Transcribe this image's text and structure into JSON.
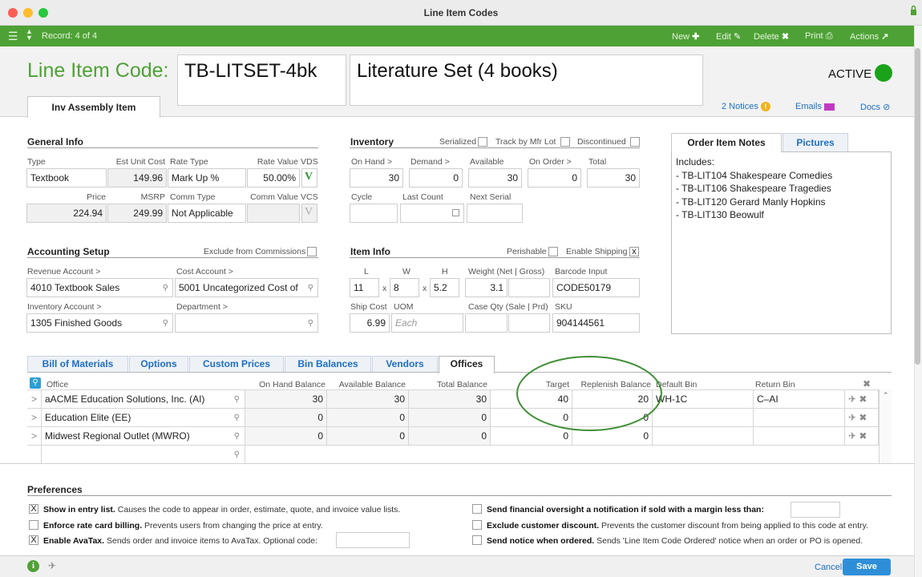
{
  "window": {
    "title": "Line Item Codes"
  },
  "toolbar": {
    "record": "Record: 4 of 4",
    "new": "New",
    "edit": "Edit",
    "delete": "Delete",
    "print": "Print",
    "actions": "Actions"
  },
  "header": {
    "code_label": "Line Item Code:",
    "code": "TB-LITSET-4bk",
    "description": "Literature Set (4 books)",
    "status": "ACTIVE",
    "type_tab": "Inv Assembly Item",
    "notices": "2 Notices",
    "emails": "Emails",
    "docs": "Docs"
  },
  "general": {
    "title": "General Info",
    "type_label": "Type",
    "type": "Textbook",
    "est_label": "Est Unit Cost",
    "est": "149.96",
    "rate_type_label": "Rate Type",
    "rate_type": "Mark Up %",
    "rate_value_label": "Rate Value",
    "rate_value": "50.00%",
    "vds_label": "VDS",
    "vds": "V",
    "price_label": "Price",
    "price": "224.94",
    "msrp_label": "MSRP",
    "msrp": "249.99",
    "comm_type_label": "Comm Type",
    "comm_type": "Not Applicable",
    "comm_value_label": "Comm Value",
    "vcs_label": "VCS",
    "vcs": "V"
  },
  "inventory": {
    "title": "Inventory",
    "serialized": "Serialized",
    "track": "Track by Mfr Lot",
    "discontinued": "Discontinued",
    "on_hand_label": "On Hand >",
    "on_hand": "30",
    "demand_label": "Demand >",
    "demand": "0",
    "available_label": "Available",
    "available": "30",
    "on_order_label": "On Order >",
    "on_order": "0",
    "total_label": "Total",
    "total": "30",
    "cycle_label": "Cycle",
    "last_count_label": "Last Count",
    "next_serial_label": "Next Serial"
  },
  "notes": {
    "tab_notes": "Order Item Notes",
    "tab_pictures": "Pictures",
    "lines": [
      "Includes:",
      "- TB-LIT104 Shakespeare Comedies",
      "- TB-LIT106 Shakespeare Tragedies",
      "- TB-LIT120 Gerard Manly Hopkins",
      "- TB-LIT130 Beowulf"
    ]
  },
  "accounting": {
    "title": "Accounting Setup",
    "exclude": "Exclude from Commissions",
    "revenue_label": "Revenue Account >",
    "revenue": "4010 Textbook Sales",
    "cost_label": "Cost Account >",
    "cost": "5001 Uncategorized Cost of",
    "inventory_label": "Inventory Account >",
    "inventory": "1305 Finished Goods",
    "department_label": "Department >"
  },
  "iteminfo": {
    "title": "Item Info",
    "perishable": "Perishable",
    "enable_shipping": "Enable Shipping",
    "shipping_check": "x",
    "l_label": "L",
    "l": "11",
    "w_label": "W",
    "w": "8",
    "h_label": "H",
    "h": "5.2",
    "x": "x",
    "weight_label": "Weight (Net | Gross)",
    "weight": "3.1",
    "barcode_label": "Barcode Input",
    "barcode": "CODE50179",
    "ship_cost_label": "Ship Cost",
    "ship_cost": "6.99",
    "uom_label": "UOM",
    "uom": "Each",
    "case_label": "Case Qty (Sale | Prd)",
    "sku_label": "SKU",
    "sku": "904144561"
  },
  "subtabs": [
    "Bill of Materials",
    "Options",
    "Custom Prices",
    "Bin Balances",
    "Vendors",
    "Offices"
  ],
  "offices": {
    "headers": {
      "office": "Office",
      "on_hand": "On Hand Balance",
      "available": "Available Balance",
      "total": "Total Balance",
      "target": "Target",
      "replenish": "Replenish Balance",
      "default_bin": "Default Bin",
      "return_bin": "Return Bin"
    },
    "rows": [
      {
        "office": "aACME Education Solutions, Inc.  (AI)",
        "on_hand": "30",
        "available": "30",
        "total": "30",
        "target": "40",
        "replenish": "20",
        "default_bin": "WH-1C",
        "return_bin": "C–AI"
      },
      {
        "office": "Education Elite  (EE)",
        "on_hand": "0",
        "available": "0",
        "total": "0",
        "target": "0",
        "replenish": "0",
        "default_bin": "",
        "return_bin": ""
      },
      {
        "office": "Midwest Regional Outlet  (MWRO)",
        "on_hand": "0",
        "available": "0",
        "total": "0",
        "target": "0",
        "replenish": "0",
        "default_bin": "",
        "return_bin": ""
      }
    ]
  },
  "preferences": {
    "title": "Preferences",
    "items": [
      {
        "bold": "Show in entry list.",
        "text": " Causes the code to appear in order, estimate, quote, and invoice value lists.",
        "checked": "X"
      },
      {
        "bold": "Enforce rate card billing.",
        "text": " Prevents users from changing the price at entry.",
        "checked": ""
      },
      {
        "bold": "Enable AvaTax.",
        "text": " Sends order and invoice items to AvaTax. Optional code:",
        "checked": "X"
      },
      {
        "bold": "Send financial oversight a notification if sold with a margin less than:",
        "text": "",
        "checked": ""
      },
      {
        "bold": "Exclude customer discount.",
        "text": " Prevents the customer discount from being applied to this code at entry.",
        "checked": ""
      },
      {
        "bold": "Send notice when ordered.",
        "text": " Sends 'Line Item Code Ordered' notice when an order or PO is opened.",
        "checked": ""
      }
    ]
  },
  "footer": {
    "cancel": "Cancel",
    "save": "Save"
  },
  "colors": {
    "green": "#4ea235",
    "blue": "#1f6fc0",
    "annotation": "#3f8f36"
  }
}
